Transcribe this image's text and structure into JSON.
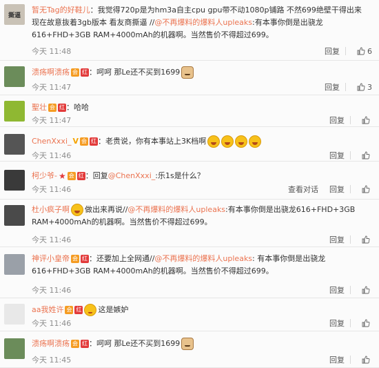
{
  "comments": [
    {
      "user": "暂无Tag的好鞋儿",
      "badges": [],
      "segments": [
        {
          "t": "：我觉得720p是为hm3a自主cpu gpu带不动1080p铺路 不然699绝壁干得出来 现在故意抜着3gb版本 看友商撕逼 //"
        },
        {
          "t": "@不再爆料的爆料人upleaks",
          "at": true
        },
        {
          "t": ":有本事你倒是出骁龙616+FHD+3GB RAM+4000mAh的机器啊。当然售价不得超过699。"
        }
      ],
      "time": "今天 11:48",
      "actions": [
        "回复"
      ],
      "likes": "6",
      "avatar": {
        "color": "#c9c2b6",
        "text": "撕逼"
      }
    },
    {
      "user": "溃疡啊溃疡",
      "badges": [
        "vip",
        "red"
      ],
      "segments": [
        {
          "t": "：呵呵 那Le还不买到1699"
        }
      ],
      "emoji": [
        "dog"
      ],
      "time": "今天 11:47",
      "actions": [
        "回复"
      ],
      "likes": "3",
      "avatar": {
        "color": "#6b8c5a",
        "text": ""
      }
    },
    {
      "user": "聖壮",
      "badges": [
        "vip",
        "red"
      ],
      "segments": [
        {
          "t": "：哈哈"
        }
      ],
      "time": "今天 11:47",
      "actions": [
        "回复"
      ],
      "likes": "",
      "avatar": {
        "color": "#8fb832",
        "text": ""
      }
    },
    {
      "user": "ChenXxxi_",
      "badges": [
        "v",
        "vip",
        "red"
      ],
      "segments": [
        {
          "t": "：老贵说，你有本事站上3K档啊"
        }
      ],
      "emoji": [
        "laugh",
        "laugh",
        "laugh",
        "laugh"
      ],
      "time": "今天 11:46",
      "actions": [
        "回复"
      ],
      "likes": "",
      "avatar": {
        "color": "#555555",
        "text": ""
      }
    },
    {
      "user": "柯少爷-",
      "badges": [
        "star",
        "vip",
        "red"
      ],
      "segments": [
        {
          "t": "：回复"
        },
        {
          "t": "@ChenXxxi_",
          "at": true
        },
        {
          "t": ":乐1s是什么？"
        }
      ],
      "time": "今天 11:46",
      "actions": [
        "查看对话",
        "回复"
      ],
      "likes": "",
      "avatar": {
        "color": "#3a3a3a",
        "text": ""
      }
    },
    {
      "user": "杜小疯子啊",
      "badges": [],
      "emoji_lead": true,
      "segments": [
        {
          "t": "做出来再说//"
        },
        {
          "t": "@不再爆料的爆料人upleaks",
          "at": true
        },
        {
          "t": ":有本事你倒是出骁龙616+FHD+3GB RAM+4000mAh的机器啊。当然售价不得超过699。"
        }
      ],
      "time": "今天 11:46",
      "actions": [
        "回复"
      ],
      "likes": "",
      "avatar": {
        "color": "#4a4a4a",
        "text": ""
      }
    },
    {
      "user": "神评小皇帝",
      "badges": [
        "vip",
        "red"
      ],
      "segments": [
        {
          "t": "：还要加上全网通//"
        },
        {
          "t": "@不再爆料的爆料人upleaks",
          "at": true
        },
        {
          "t": ": 有本事你倒是出骁龙616+FHD+3GB RAM+4000mAh的机器啊。当然售价不得超过699。"
        }
      ],
      "time": "今天 11:46",
      "actions": [
        "回复"
      ],
      "likes": "",
      "avatar": {
        "color": "#9aa0a8",
        "text": ""
      }
    },
    {
      "user": "aa我姓许",
      "badges": [
        "vip",
        "red"
      ],
      "segments": [
        {
          "t": "这是嫉妒"
        }
      ],
      "emoji_think": true,
      "time": "今天 11:46",
      "actions": [
        "回复"
      ],
      "likes": "",
      "avatar": {
        "color": "#e8e8e8",
        "text": ""
      }
    },
    {
      "user": "溃疡啊溃疡",
      "badges": [
        "vip",
        "red"
      ],
      "segments": [
        {
          "t": "：呵呵 那Le还不买到1699"
        }
      ],
      "emoji": [
        "dog"
      ],
      "time": "今天 11:45",
      "actions": [
        "回复"
      ],
      "likes": "",
      "avatar": {
        "color": "#6b8c5a",
        "text": ""
      }
    }
  ],
  "icons": {
    "like": "thumbs-up-icon"
  },
  "colors": {
    "name": "#eb7350",
    "time": "#8d8d8d"
  }
}
